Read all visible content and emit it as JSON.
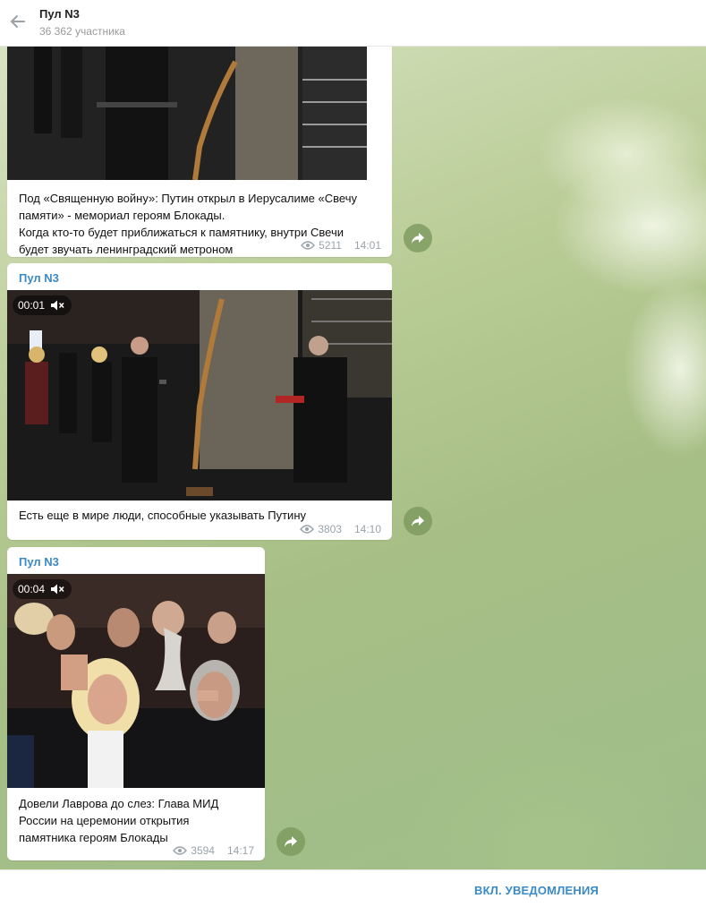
{
  "header": {
    "title": "Пул N3",
    "subtitle": "36 362 участника",
    "back_icon": "arrow-left-icon"
  },
  "messages": [
    {
      "sender": "",
      "caption_lines": [
        "Под «Священную войну»: Путин открыл в Иерусалиме «Свечу",
        "памяти» - мемориал героям Блокады.",
        "Когда кто-то будет приближаться к памятнику, внутри Свечи",
        "будет звучать ленинградский метроном"
      ],
      "views": "5211",
      "time": "14:01"
    },
    {
      "sender": "Пул N3",
      "duration": "00:01",
      "caption_lines": [
        "Есть еще в мире люди, способные указывать Путину"
      ],
      "views": "3803",
      "time": "14:10"
    },
    {
      "sender": "Пул N3",
      "duration": "00:04",
      "caption_lines": [
        "Довели Лаврова до слез: Глава МИД",
        "России на церемонии открытия",
        "памятника героям Блокады"
      ],
      "views": "3594",
      "time": "14:17"
    }
  ],
  "footer": {
    "notify_label": "ВКЛ. УВЕДОМЛЕНИЯ"
  },
  "colors": {
    "accent": "#3a8ac7",
    "meta": "#9aa3ab"
  }
}
